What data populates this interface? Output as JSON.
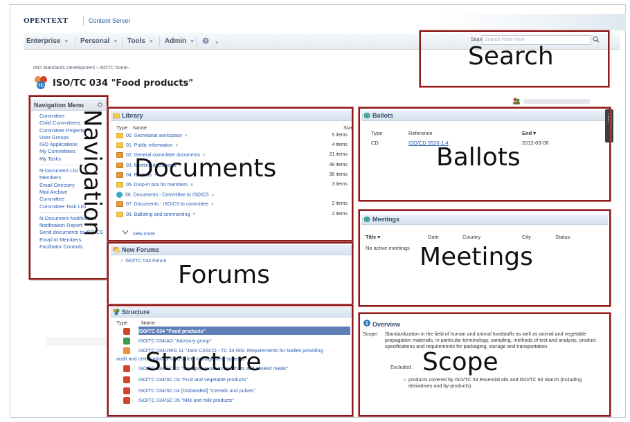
{
  "header": {
    "brand": "OPENTEXT",
    "product": "Content Server",
    "nav": [
      "Enterprise",
      "Personal",
      "Tools",
      "Admin"
    ],
    "search_label": "Search",
    "search_placeholder": "Search From Here"
  },
  "breadcrumb": "ISO Standards Development › ISOTC home ›",
  "page_title": "ISO/TC 034 \"Food products\"",
  "navigation_menu": {
    "title": "Navigation Menu",
    "links_group1": [
      "Committee",
      "Child Committees",
      "Committee Projects",
      "User Groups",
      "ISO Applications",
      "My Committees",
      "My Tasks"
    ],
    "links_group2": [
      "N-Document List",
      "Members",
      "Email Directory",
      "Mail Archive",
      "Committee",
      "Committee Task List"
    ],
    "links_group3": [
      "N-Document Notification",
      "Notification Report",
      "Send documents to ISO/CS",
      "Email to Members",
      "Facilitator Controls"
    ]
  },
  "library": {
    "title": "Library",
    "col_type": "Type",
    "col_name": "Name",
    "col_size": "Size",
    "rows": [
      {
        "name": "00. Secretariat workspace",
        "size": "5 items",
        "icon": "yellow"
      },
      {
        "name": "01. Public information",
        "size": "4 items",
        "icon": "yellow"
      },
      {
        "name": "02. General committee documents",
        "size": "21 items",
        "icon": "orange"
      },
      {
        "name": "03. Meeting documents",
        "size": "48 items",
        "icon": "orange"
      },
      {
        "name": "04. Projects",
        "size": "38 items",
        "icon": "orange"
      },
      {
        "name": "05. Drop-in box for members",
        "size": "3 items",
        "icon": "yellow"
      },
      {
        "name": "06. Documents - Committee to ISO/CS",
        "size": "",
        "icon": "globe"
      },
      {
        "name": "07. Documents - ISO/CS to committee",
        "size": "2 items",
        "icon": "orange"
      },
      {
        "name": "08. Balloting and commenting",
        "size": "2 items",
        "icon": "yellow"
      }
    ],
    "view_more": "view more"
  },
  "forums": {
    "title": "New Forums",
    "items": [
      "ISO/TC 034 Forum"
    ]
  },
  "structure": {
    "title": "Structure",
    "col_type": "Type",
    "col_name": "Name",
    "rows": [
      "ISO/TC 034 \"Food products\"",
      "ISO/TC 034/AG \"Advisory group\"",
      "ISO/TC 034/JWG 11 \"Joint CASCO - TC 34 WG: Requirements for bodies providing",
      "audit and certification of food safety management systems\"",
      "ISO/TC 034/SC 02 \"Oleaginous seeds and fruits and oilseed meals\"",
      "ISO/TC 034/SC 03 \"Fruit and vegetable products\"",
      "ISO/TC 034/SC 04 [Disbanded] \"Cereals and pulses\"",
      "ISO/TC 034/SC 05 \"Milk and milk products\""
    ]
  },
  "ballots": {
    "title": "Ballots",
    "col_type": "Type",
    "col_reference": "Reference",
    "col_end": "End ▾",
    "rows": [
      {
        "type": "CD",
        "reference": "ISO/CD 5526-1.4",
        "end": "2012-03-08"
      }
    ]
  },
  "meetings": {
    "title": "Meetings",
    "cols": [
      "Title ▾",
      "Date",
      "Country",
      "City",
      "Status"
    ],
    "empty": "No active meetings"
  },
  "overview": {
    "title": "Overview",
    "scope_label": "Scope:",
    "scope_text": "Standardization in the field of human and animal foodstuffs as well as animal and vegetable propagation materials, in particular terminology, sampling, methods of test and analysis, product specifications and requirements for packaging, storage and transportation.",
    "excluded_label": "Excluded :",
    "excluded_item": "products covered by ISO/TC 54 Essential oils and ISO/TC 93 Starch (including derivatives and by-products)."
  },
  "annotations": {
    "search": "Search",
    "navigation": "Navigation",
    "documents": "Documents",
    "ballots": "Ballots",
    "meetings": "Meetings",
    "forums": "Forums",
    "structure": "Structure",
    "scope": "Scope"
  },
  "colors": {
    "annotation_border": "#8b1a1a",
    "link": "#2a5db0",
    "panel_header": "#d7e3ef"
  }
}
